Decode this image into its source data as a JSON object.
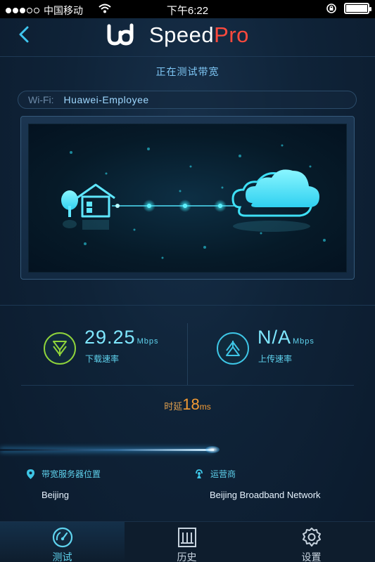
{
  "status_bar": {
    "carrier": "中国移动",
    "time": "下午6:22"
  },
  "header": {
    "brand_speed": "Speed",
    "brand_pro": "Pro"
  },
  "subtitle": "正在测试带宽",
  "wifi": {
    "label": "Wi-Fi:",
    "name": "Huawei-Employee"
  },
  "download": {
    "value": "29.25",
    "unit": "Mbps",
    "label": "下载速率"
  },
  "upload": {
    "value": "N/A",
    "unit": "Mbps",
    "label": "上传速率"
  },
  "latency": {
    "label": "时延",
    "value": "18",
    "unit": "ms"
  },
  "progress": {
    "fraction": 0.57
  },
  "server": {
    "label": "带宽服务器位置",
    "value": "Beijing"
  },
  "isp": {
    "label": "运营商",
    "value": "Beijing Broadband Network"
  },
  "tabs": [
    {
      "label": "测试",
      "icon": "gauge-icon",
      "active": true
    },
    {
      "label": "历史",
      "icon": "history-icon",
      "active": false
    },
    {
      "label": "设置",
      "icon": "gear-icon",
      "active": false
    }
  ],
  "colors": {
    "accent": "#5fd3ee",
    "brand_pro": "#ff4a3d",
    "latency": "#f49b34",
    "download_ring": "#8fd43b",
    "background": "#0f2338"
  }
}
